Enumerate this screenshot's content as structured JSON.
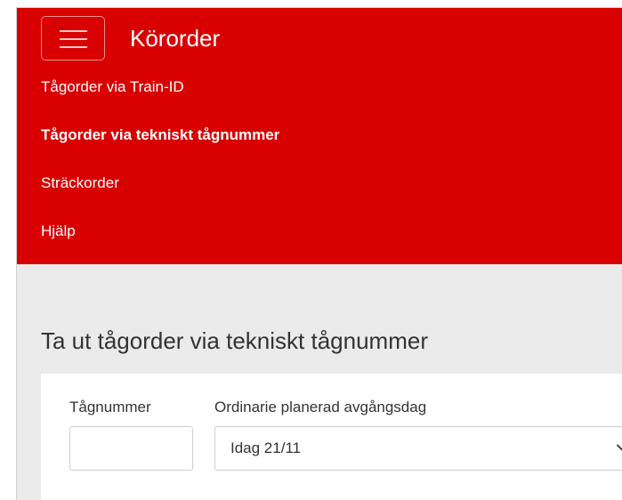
{
  "app": {
    "title": "Körorder",
    "menu_icon": "hamburger-menu-icon",
    "brand_color": "#d80000"
  },
  "nav": {
    "items": [
      {
        "label": "Tågorder via Train-ID",
        "active": false
      },
      {
        "label": "Tågorder via tekniskt tågnummer",
        "active": true
      },
      {
        "label": "Sträckorder",
        "active": false
      },
      {
        "label": "Hjälp",
        "active": false
      }
    ]
  },
  "main": {
    "heading": "Ta ut tågorder via tekniskt tågnummer",
    "form": {
      "train_number": {
        "label": "Tågnummer",
        "value": "",
        "placeholder": ""
      },
      "departure_day": {
        "label": "Ordinarie planerad avgångsdag",
        "selected": "Idag 21/11",
        "icon": "chevron-down-icon"
      }
    }
  }
}
